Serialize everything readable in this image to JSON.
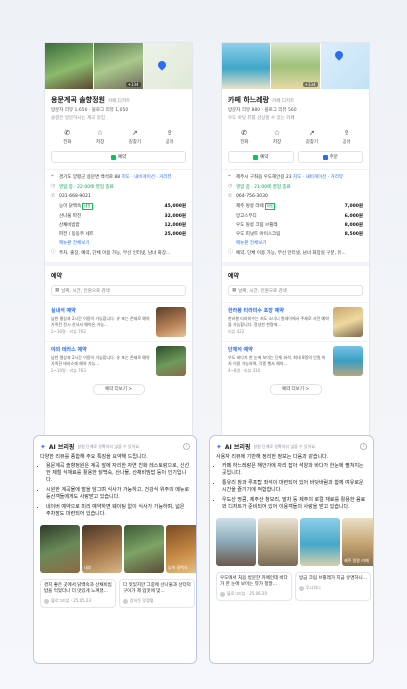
{
  "left": {
    "photo_badge": "+134",
    "name": "용문계곡 솔향정원",
    "category": "카페,디저트",
    "reviews": "방문자 리뷰 1,650 · 블로그 리뷰 1,050",
    "tagline": "솔향은 방문하시는 계곡 맛집",
    "actions": [
      "전화",
      "저장",
      "길찾기",
      "공유"
    ],
    "buttons": [
      "예약"
    ],
    "address": "경기도 양평군 용문면 백석로 88",
    "address_link": "지도 · 내비게이션 · 거리뷰",
    "hours": "영업 중 · 22:00에 영업 종료",
    "phone": "031-668-9021",
    "menu": [
      {
        "name": "능이 닭백숙",
        "tag": "대표",
        "price": "45,000원"
      },
      {
        "name": "산나물 파전",
        "tag": "",
        "price": "32,000원"
      },
      {
        "name": "산채비빔밥",
        "tag": "",
        "price": "12,000원"
      },
      {
        "name": "파전 / 동동주 세트",
        "tag": "",
        "price": "25,000원"
      }
    ],
    "menu_more": "메뉴판 전체보기",
    "facilities": "주차, 출장, 예약, 단체 이용 가능, 무선 인터넷, 남녀 화장...",
    "reservation_title": "예약",
    "select_placeholder": "날짜, 시간, 인원으로 검색",
    "reservations": [
      {
        "title": "실내석 예약",
        "desc": "남한 평상과 2시간 이용이 가능합니다. 유 포는 존재로 예약 가족전 전시 산사서 예약은 가능...",
        "meta": "2~10명 · 리뷰 763"
      },
      {
        "title": "야외 테라스 예약",
        "desc": "남한 평상과 2시간 이용이 가능합니다. 유 포는 존재로 예약 가족전 테라스에 예약 가능...",
        "meta": "2~10명 · 리뷰 763"
      }
    ],
    "more_button": "예약 더보기 >",
    "ai_title": "AI 브리핑",
    "ai_note": "실험 단계로 정확하지 않을 수 있어요.",
    "ai_lead": "다양한 리뷰를 종합해 주요 특징을 요약해 드립니다.",
    "ai_bullets": [
      "용문계곡 솔향정원은 계곡 앞에 자리한 자연 친화 레스토랑으로, 신선한 제철 식재료를 활용한 닭백숙, 산나물, 산채비빔밥 등이 인기입니다.",
      "시원한 계곡물에 발을 담그며 식사가 가능하고, 건강식 위주의 메뉴로 등산객들에게도 사랑받고 있습니다.",
      "네이버 예약으로 미리 예약하면 웨이팅 없이 식사가 가능하며, 넓은 주차장도 마련되어 있습니다."
    ],
    "gallery_caps": [
      "",
      "내부",
      "",
      "능이 닭백숙"
    ],
    "review_cards": [
      {
        "text": "경치 좋은 곳에서 닭백숙과 산채비빔밥을 먹었더니 더 맛있게 느껴졌...",
        "meta": "블로그리뷰 · 25.05.23"
      },
      {
        "text": "다 맛있지만 그중에 산나물과 산더덕 구이가 제 입맛에 맞...",
        "meta": "장하듯 맛쟁혈"
      }
    ]
  },
  "right": {
    "photo_badge": "+134",
    "name": "카페 하느레랑",
    "category": "카페,디저트",
    "reviews": "방문자 리뷰 880 · 블로그 리뷰 560",
    "tagline": "우도 바닷 뷰를 감상할 수 있는 카페",
    "actions": [
      "전화",
      "저장",
      "길찾기",
      "공유"
    ],
    "buttons": [
      "예약",
      "주문"
    ],
    "address": "제주시 구좌읍 우도해안길 23",
    "address_link": "지도 · 내비게이션 · 거리뷰",
    "hours": "영업 중 · 21:00에 영업 종료",
    "phone": "064-756-3030",
    "menu": [
      {
        "name": "제주 땅콩 라떼",
        "tag": "대표",
        "price": "7,000원"
      },
      {
        "name": "망고스무디",
        "tag": "",
        "price": "6,000원"
      },
      {
        "name": "우도 땅콩 크림 브륄레",
        "tag": "",
        "price": "8,000원"
      },
      {
        "name": "우도 피넛트 아이스크림",
        "tag": "",
        "price": "8,500원"
      }
    ],
    "menu_more": "메뉴판 전체보기",
    "facilities": "예약, 단체 이용 가능, 무선 인터넷, 남녀 화장실 구분, 유...",
    "reservation_title": "예약",
    "select_placeholder": "날짜, 시간, 인원으로 검색",
    "reservations": [
      {
        "title": "한라봉 티라미수 포장 예약",
        "desc": "한라봉 티라미수는 지도 소녀니 원데이에서 주제로 사전 예약을 가능합니다. 정성한 한명에...",
        "meta": "리뷰 422"
      },
      {
        "title": "단체석 예약",
        "desc": "우도 바다가 한 눈에 보이는 단체 좌석. 최대 8명의 인원 까지 이용 가능하며, 각종 행사 예약...",
        "meta": "4~8명 · 리뷰 310"
      }
    ],
    "more_button": "예약 더보기 >",
    "ai_title": "AI 브리핑",
    "ai_note": "실험 단계로 정확하지 않을 수 있어요.",
    "ai_lead": "사용자 리뷰에 기반해 정리한 정보는 다음과 같습니다.",
    "ai_bullets": [
      "카페 하느레랑은 해안가에 자리 잡아 석양과 바다가 한눈에 펼쳐지는 곳입니다.",
      "통유리 창과 루프탑 좌석이 마련되어 있어 바닷바람과 함께 여유로운 시간을 즐기기에 적합합니다.",
      "우도산 땅콩, 제주산 청보리, 말차 등 제주의 로컬 재료를 활용한 음료와 디저트가 준비되어 있어 이용객들의 사랑을 받고 있습니다."
    ],
    "gallery_caps": [
      "",
      "",
      "",
      "제주 땅콩 라떼"
    ],
    "review_cards": [
      {
        "text": "우도에서 처음 방문한 카페인데 바다가 한 눈에 보이는 뷰가 정말...",
        "meta": "블로그리뷰 · 25.06.20"
      },
      {
        "text": "방금 크림 브륄레가 지금 유명하니...",
        "meta": "투니와니"
      }
    ]
  }
}
